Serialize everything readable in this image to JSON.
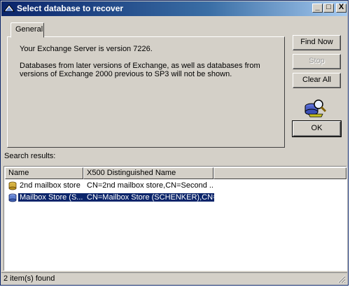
{
  "window": {
    "title": "Select database to recover",
    "controls": [
      "_",
      "□",
      "X"
    ]
  },
  "tabs": [
    {
      "label": "General"
    }
  ],
  "info": {
    "line1": "Your Exchange Server is version 7226.",
    "line2": "Databases from later versions of Exchange, as well as databases from",
    "line3": "versions of Exchange 2000 previous to SP3 will not be shown."
  },
  "buttons": {
    "find_now": "Find Now",
    "stop": "Stop",
    "clear_all": "Clear All",
    "ok": "OK"
  },
  "search_results_label": "Search results:",
  "table": {
    "columns": [
      "Name",
      "X500 Distinguished Name"
    ],
    "rows": [
      {
        "name": "2nd mailbox store",
        "dn": "CN=2nd mailbox store,CN=Second ...",
        "selected": false
      },
      {
        "name": "Mailbox Store (S...",
        "dn": "CN=Mailbox Store (SCHENKER),CN=...",
        "selected": true
      }
    ]
  },
  "status": "2 item(s) found",
  "colors": {
    "title_start": "#0a246a",
    "title_end": "#a6caf0",
    "face": "#d4d0c8",
    "selection": "#0a246a"
  },
  "icons": [
    "window-app-icon",
    "search-database-icon",
    "database-icon"
  ]
}
